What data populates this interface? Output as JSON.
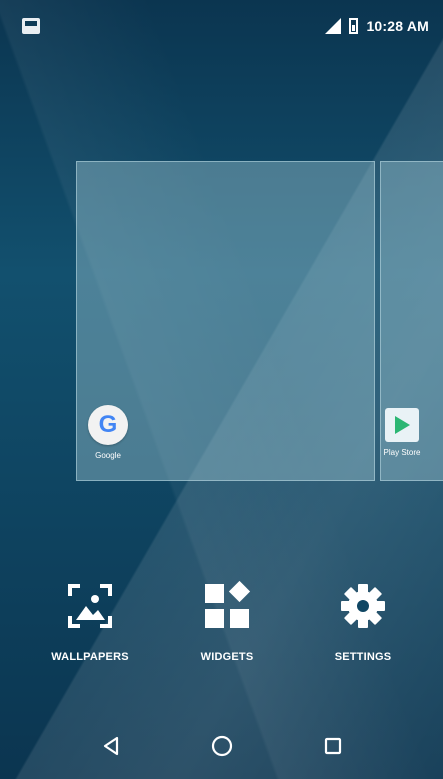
{
  "status_bar": {
    "time": "10:28 AM",
    "icons": [
      "notification-icon",
      "signal-icon",
      "battery-icon"
    ]
  },
  "home_screens": {
    "main_app": {
      "label": "Google",
      "icon": "google-icon"
    },
    "next_app": {
      "label": "Play Store",
      "icon": "play-store-icon"
    }
  },
  "options": {
    "wallpapers": {
      "label": "WALLPAPERS",
      "icon": "wallpaper-icon"
    },
    "widgets": {
      "label": "WIDGETS",
      "icon": "widgets-icon"
    },
    "settings": {
      "label": "SETTINGS",
      "icon": "gear-icon"
    }
  },
  "nav_bar": {
    "icons": [
      "back-icon",
      "home-icon",
      "recents-icon"
    ]
  },
  "colors": {
    "background": "#0e3b56",
    "preview_panel": "#9fc4cf",
    "text": "#ffffff"
  }
}
